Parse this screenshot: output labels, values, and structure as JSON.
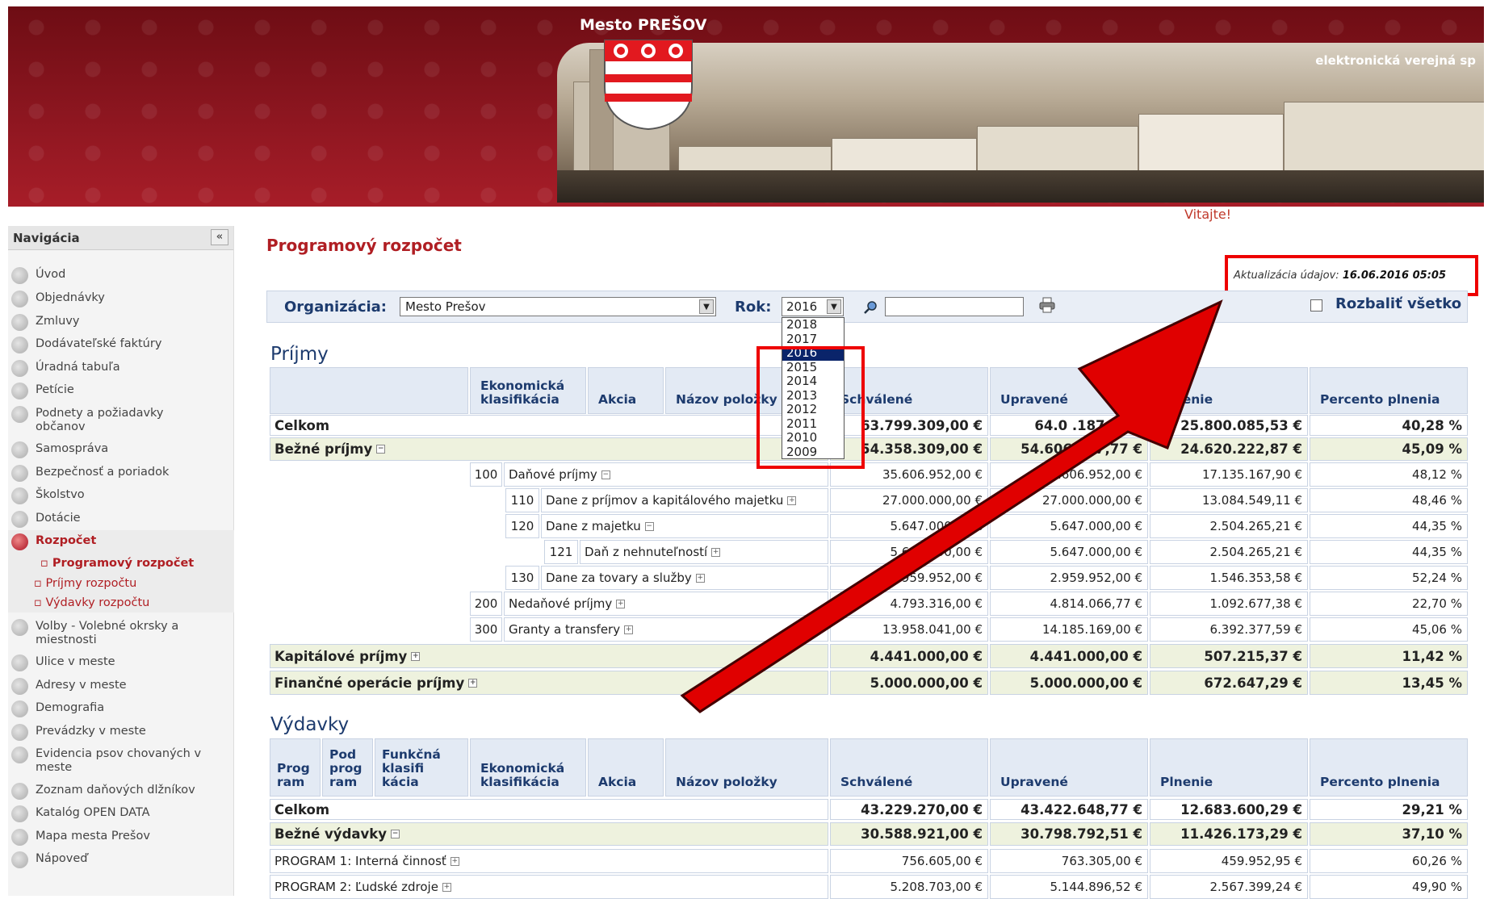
{
  "header": {
    "town": "Mesto PREŠOV",
    "tagline": "elektronická verejná sp"
  },
  "welcome": "Vitajte!",
  "nav": {
    "title": "Navigácia",
    "collapse": "«",
    "items": [
      "Úvod",
      "Objednávky",
      "Zmluvy",
      "Dodávateľské faktúry",
      "Úradná tabuľa",
      "Petície",
      "Podnety a požiadavky občanov",
      "Samospráva",
      "Bezpečnosť a poriadok",
      "Školstvo",
      "Dotácie",
      "Rozpočet",
      "Volby - Volebné okrsky a miestnosti",
      "Ulice v meste",
      "Adresy v meste",
      "Demografia",
      "Prevádzky v meste",
      "Evidencia psov chovaných v meste",
      "Zoznam daňových dlžníkov",
      "Katalóg OPEN DATA",
      "Mapa mesta Prešov",
      "Nápoveď"
    ],
    "sub": [
      "Programový rozpočet",
      "Príjmy rozpočtu",
      "Výdavky rozpočtu"
    ]
  },
  "page": {
    "title": "Programový rozpočet",
    "update_label": "Aktualizácia údajov:",
    "update_value": "16.06.2016 05:05",
    "org_label": "Organizácia:",
    "org_value": "Mesto Prešov",
    "rok_label": "Rok:",
    "year": "2016",
    "years": [
      "2018",
      "2017",
      "2016",
      "2015",
      "2014",
      "2013",
      "2012",
      "2011",
      "2010",
      "2009"
    ],
    "expand": "Rozbaliť všetko"
  },
  "income": {
    "title": "Príjmy",
    "headers": [
      "Ekonomická klasifikácia",
      "Akcia",
      "Názov položky",
      "Schválené",
      "Upravené",
      "Plnenie",
      "Percento plnenia"
    ],
    "rows": [
      {
        "code": "",
        "name": "Celkom",
        "a": "63.799.309,00 €",
        "b": "64.0  .187,77 €",
        "c": "25.800.085,53 €",
        "p": "40,28 %"
      },
      {
        "code": "",
        "name": "Bežné príjmy",
        "a": "54.358.309,00 €",
        "b": "54.606.187,77 €",
        "c": "24.620.222,87 €",
        "p": "45,09 %"
      },
      {
        "code": "100",
        "name": "Daňové príjmy",
        "a": "35.606.952,00 €",
        "b": "35.606.952,00 €",
        "c": "17.135.167,90 €",
        "p": "48,12 %"
      },
      {
        "code": "110",
        "name": "Dane z príjmov a kapitálového majetku",
        "a": "27.000.000,00 €",
        "b": "27.000.000,00 €",
        "c": "13.084.549,11 €",
        "p": "48,46 %"
      },
      {
        "code": "120",
        "name": "Dane z majetku",
        "a": "5.647.000,00 €",
        "b": "5.647.000,00 €",
        "c": "2.504.265,21 €",
        "p": "44,35 %"
      },
      {
        "code": "121",
        "name": "Daň z nehnuteľností",
        "a": "5.647.000,00 €",
        "b": "5.647.000,00 €",
        "c": "2.504.265,21 €",
        "p": "44,35 %"
      },
      {
        "code": "130",
        "name": "Dane za tovary a služby",
        "a": "2.959.952,00 €",
        "b": "2.959.952,00 €",
        "c": "1.546.353,58 €",
        "p": "52,24 %"
      },
      {
        "code": "200",
        "name": "Nedaňové príjmy",
        "a": "4.793.316,00 €",
        "b": "4.814.066,77 €",
        "c": "1.092.677,38 €",
        "p": "22,70 %"
      },
      {
        "code": "300",
        "name": "Granty a transfery",
        "a": "13.958.041,00 €",
        "b": "14.185.169,00 €",
        "c": "6.392.377,59 €",
        "p": "45,06 %"
      },
      {
        "code": "",
        "name": "Kapitálové príjmy",
        "a": "4.441.000,00 €",
        "b": "4.441.000,00 €",
        "c": "507.215,37 €",
        "p": "11,42 %"
      },
      {
        "code": "",
        "name": "Finančné operácie príjmy",
        "a": "5.000.000,00 €",
        "b": "5.000.000,00 €",
        "c": "672.647,29 €",
        "p": "13,45 %"
      }
    ]
  },
  "expenses": {
    "title": "Výdavky",
    "headers": [
      "Prog ram",
      "Pod prog ram",
      "Funkčná klasifi kácia",
      "Ekonomická klasifikácia",
      "Akcia",
      "Názov položky",
      "Schválené",
      "Upravené",
      "Plnenie",
      "Percento plnenia"
    ],
    "rows": [
      {
        "name": "Celkom",
        "a": "43.229.270,00 €",
        "b": "43.422.648,77 €",
        "c": "12.683.600,29 €",
        "p": "29,21 %"
      },
      {
        "name": "Bežné výdavky",
        "a": "30.588.921,00 €",
        "b": "30.798.792,51 €",
        "c": "11.426.173,29 €",
        "p": "37,10 %"
      },
      {
        "name": "PROGRAM 1: Interná činnosť",
        "a": "756.605,00 €",
        "b": "763.305,00 €",
        "c": "459.952,95 €",
        "p": "60,26 %"
      },
      {
        "name": "PROGRAM 2: Ľudské zdroje",
        "a": "5.208.703,00 €",
        "b": "5.144.896,52 €",
        "c": "2.567.399,24 €",
        "p": "49,90 %"
      }
    ]
  },
  "colors": {
    "accent": "#b01e23",
    "header_blue": "#1d3b6e",
    "annotation_red": "#e00000"
  }
}
